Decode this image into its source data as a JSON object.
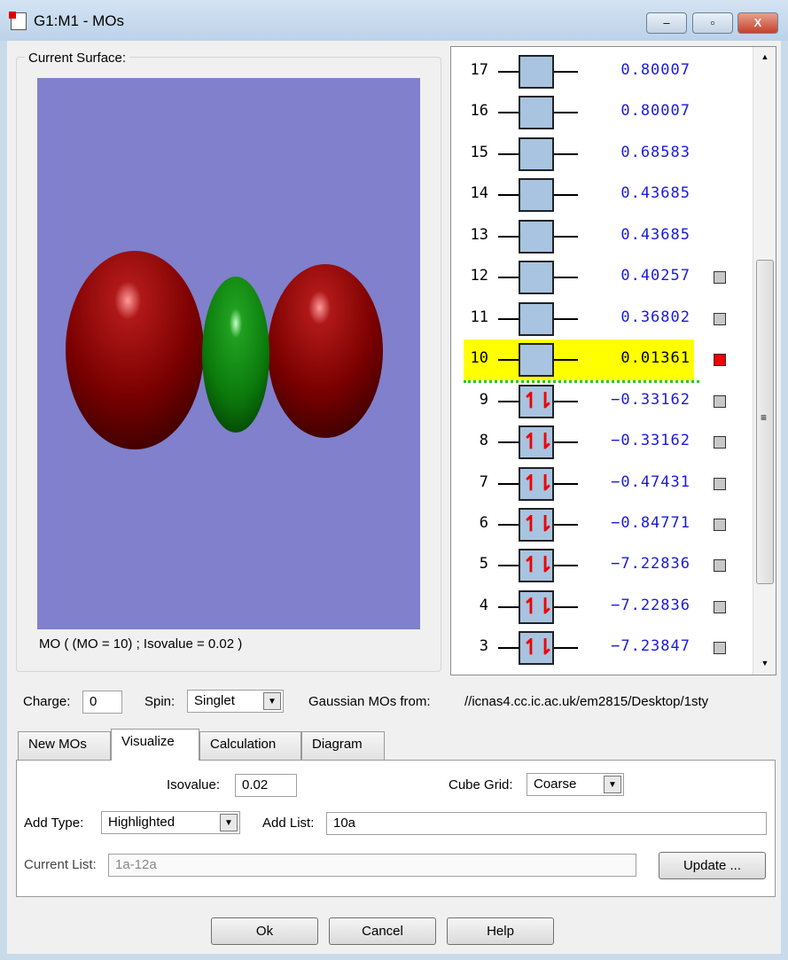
{
  "window": {
    "title": "G1:M1 - MOs",
    "minimize": "–",
    "maximize": "▫",
    "close": "X"
  },
  "surface": {
    "group_label": "Current Surface:",
    "caption": "MO ( (MO = 10) ; Isovalue = 0.02 )",
    "background": "#8080cc"
  },
  "orbitals": [
    {
      "n": "17",
      "energy": "0.80007",
      "occupied": false,
      "selected": false,
      "checkbox": false
    },
    {
      "n": "16",
      "energy": "0.80007",
      "occupied": false,
      "selected": false,
      "checkbox": false
    },
    {
      "n": "15",
      "energy": "0.68583",
      "occupied": false,
      "selected": false,
      "checkbox": false
    },
    {
      "n": "14",
      "energy": "0.43685",
      "occupied": false,
      "selected": false,
      "checkbox": false
    },
    {
      "n": "13",
      "energy": "0.43685",
      "occupied": false,
      "selected": false,
      "checkbox": false
    },
    {
      "n": "12",
      "energy": "0.40257",
      "occupied": false,
      "selected": false,
      "checkbox": true
    },
    {
      "n": "11",
      "energy": "0.36802",
      "occupied": false,
      "selected": false,
      "checkbox": true
    },
    {
      "n": "10",
      "energy": "0.01361",
      "occupied": false,
      "selected": true,
      "checkbox": true
    },
    {
      "n": "9",
      "energy": "−0.33162",
      "occupied": true,
      "selected": false,
      "checkbox": true
    },
    {
      "n": "8",
      "energy": "−0.33162",
      "occupied": true,
      "selected": false,
      "checkbox": true
    },
    {
      "n": "7",
      "energy": "−0.47431",
      "occupied": true,
      "selected": false,
      "checkbox": true
    },
    {
      "n": "6",
      "energy": "−0.84771",
      "occupied": true,
      "selected": false,
      "checkbox": true
    },
    {
      "n": "5",
      "energy": "−7.22836",
      "occupied": true,
      "selected": false,
      "checkbox": true
    },
    {
      "n": "4",
      "energy": "−7.22836",
      "occupied": true,
      "selected": false,
      "checkbox": true
    },
    {
      "n": "3",
      "energy": "−7.23847",
      "occupied": true,
      "selected": false,
      "checkbox": true
    }
  ],
  "electron_pair_glyph": "↿⇂",
  "settings": {
    "charge_label": "Charge:",
    "charge": "0",
    "spin_label": "Spin:",
    "spin": "Singlet",
    "source_label": "Gaussian MOs from:",
    "source": "//icnas4.cc.ic.ac.uk/em2815/Desktop/1sty"
  },
  "tabs": [
    "New MOs",
    "Visualize",
    "Calculation",
    "Diagram"
  ],
  "visualize": {
    "isovalue_label": "Isovalue:",
    "isovalue": "0.02",
    "cube_grid_label": "Cube Grid:",
    "cube_grid": "Coarse",
    "add_type_label": "Add Type:",
    "add_type": "Highlighted",
    "add_list_label": "Add List:",
    "add_list": "10a",
    "current_list_label": "Current List:",
    "current_list": "1a-12a",
    "update": "Update ..."
  },
  "buttons": {
    "ok": "Ok",
    "cancel": "Cancel",
    "help": "Help"
  },
  "scroll": {
    "up": "▲",
    "down": "▼",
    "grip": "≡"
  }
}
